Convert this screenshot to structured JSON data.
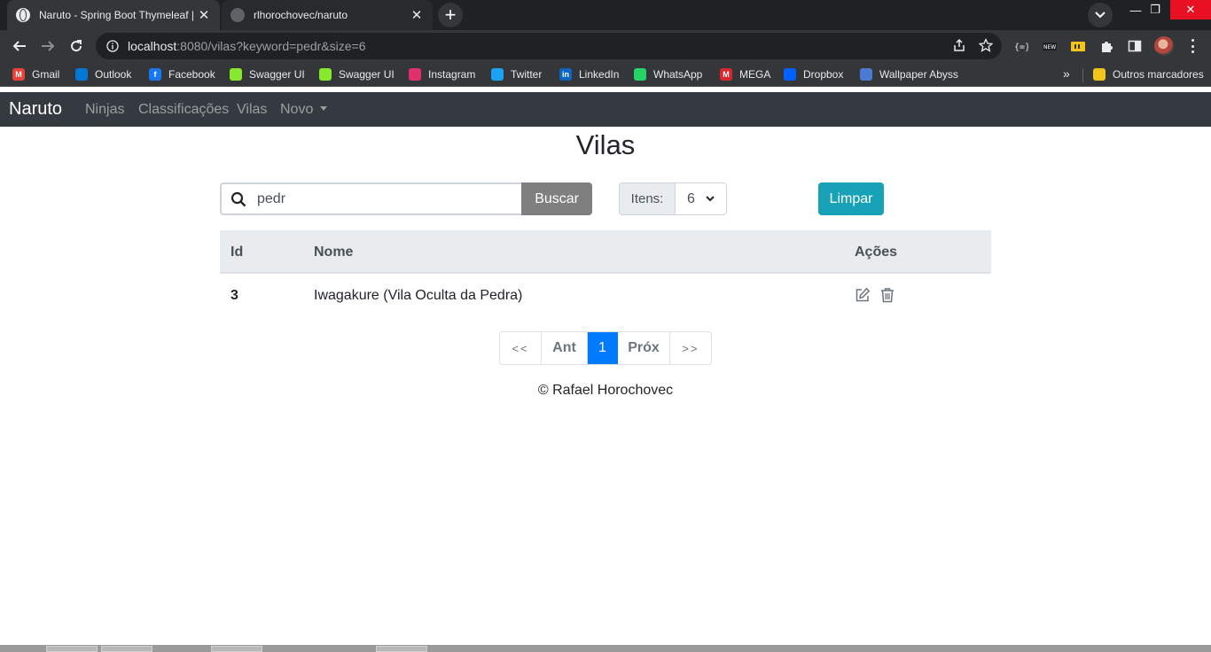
{
  "browser": {
    "tabs": [
      {
        "title": "Naruto - Spring Boot Thymeleaf |",
        "active": true,
        "favicon": "globe-icon"
      },
      {
        "title": "rlhorochovec/naruto",
        "active": false,
        "favicon": "github-icon"
      }
    ],
    "url_host": "localhost",
    "url_rest": ":8080/vilas?keyword=pedr&size=6",
    "bookmarks": [
      {
        "label": "Gmail",
        "icon": "gmail-icon",
        "color": "#ea4335"
      },
      {
        "label": "Outlook",
        "icon": "outlook-icon",
        "color": "#0078d4"
      },
      {
        "label": "Facebook",
        "icon": "facebook-icon",
        "color": "#1877f2"
      },
      {
        "label": "Swagger UI",
        "icon": "swagger-icon",
        "color": "#85ea2d"
      },
      {
        "label": "Swagger UI",
        "icon": "swagger-icon",
        "color": "#85ea2d"
      },
      {
        "label": "Instagram",
        "icon": "instagram-icon",
        "color": "#e1306c"
      },
      {
        "label": "Twitter",
        "icon": "twitter-icon",
        "color": "#1da1f2"
      },
      {
        "label": "LinkedIn",
        "icon": "linkedin-icon",
        "color": "#0a66c2"
      },
      {
        "label": "WhatsApp",
        "icon": "whatsapp-icon",
        "color": "#25d366"
      },
      {
        "label": "MEGA",
        "icon": "mega-icon",
        "color": "#d9272e"
      },
      {
        "label": "Dropbox",
        "icon": "dropbox-icon",
        "color": "#0061ff"
      },
      {
        "label": "Wallpaper Abyss",
        "icon": "wallpaper-abyss-icon",
        "color": "#4a7bd0"
      }
    ],
    "more_bookmarks": "»",
    "other_bookmarks": "Outros marcadores"
  },
  "navbar": {
    "brand": "Naruto",
    "links": [
      "Ninjas",
      "Classificações",
      "Vilas",
      "Novo"
    ]
  },
  "page": {
    "title": "Vilas",
    "search": {
      "value": "pedr",
      "button": "Buscar"
    },
    "itens": {
      "label": "Itens:",
      "selected": "6"
    },
    "clear_button": "Limpar",
    "table": {
      "headers": [
        "Id",
        "Nome",
        "Ações"
      ],
      "rows": [
        {
          "id": "3",
          "nome": "Iwagakure (Vila Oculta da Pedra)"
        }
      ]
    },
    "pagination": [
      "<<",
      "Ant",
      "1",
      "Próx",
      ">>"
    ],
    "current_page": "1",
    "footer": "© Rafael Horochovec"
  },
  "colors": {
    "navbar_bg": "#343a40",
    "search_button": "#7f7f7f",
    "clear_button": "#17a2b8",
    "active_page": "#007bff",
    "table_header_bg": "#e9ecef"
  }
}
